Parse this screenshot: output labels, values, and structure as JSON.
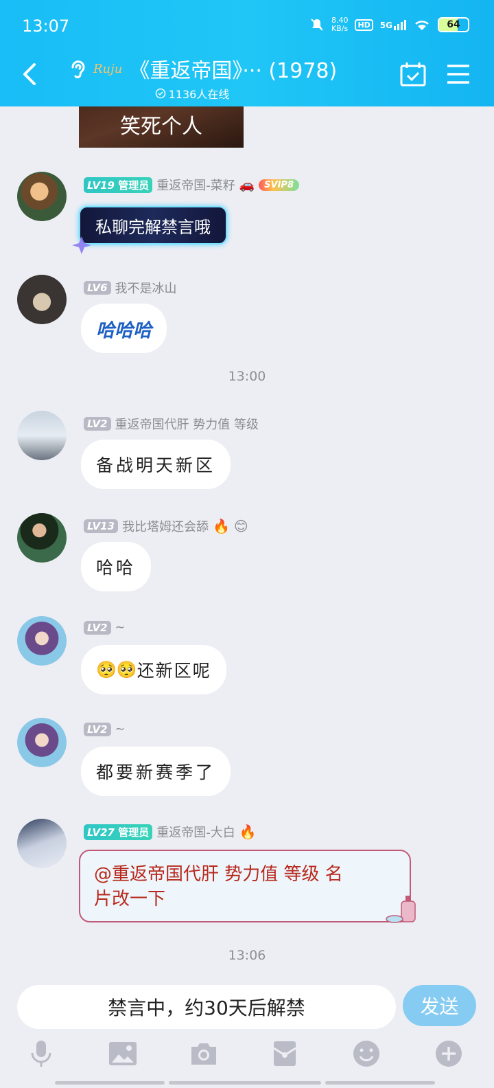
{
  "status": {
    "time": "13:07",
    "net_speed_value": "8.40",
    "net_speed_unit": "KB/s",
    "hd": "HD",
    "signal": "5G",
    "battery": "64",
    "battery_level": 0.64
  },
  "header": {
    "title": "《重返帝国》··· (1978)",
    "logo_text": "Ruju",
    "online": "1136人在线"
  },
  "messages": {
    "image_caption": "笑死个人",
    "m1": {
      "level": "LV19",
      "role": "管理员",
      "name": "重返帝国-菜籽",
      "badge": "SVIP8",
      "text": "私聊完解禁言哦"
    },
    "m2": {
      "level": "LV6",
      "name": "我不是冰山",
      "text": "哈哈哈"
    },
    "ts1": "13:00",
    "m3": {
      "level": "LV2",
      "name": "重返帝国代肝 势力值 等级",
      "text": "备战明天新区"
    },
    "m4": {
      "level": "LV13",
      "name": "我比塔姆还会舔",
      "text": "哈哈"
    },
    "m5": {
      "level": "LV2",
      "name": "~",
      "text": "还新区呢"
    },
    "m6": {
      "level": "LV2",
      "name": "~",
      "text": "都要新赛季了"
    },
    "m7": {
      "level": "LV27",
      "role": "管理员",
      "name": "重返帝国-大白",
      "text_line1": "@重返帝国代肝 势力值 等级 名",
      "text_line2": "片改一下"
    },
    "ts2": "13:06"
  },
  "input": {
    "placeholder": "禁言中，约30天后解禁",
    "send": "发送"
  },
  "colors": {
    "header_start": "#19bdf7",
    "send_button": "#86ccf2",
    "admin_badge": "#2fc6c6",
    "level_badge": "#b7b9c5",
    "background": "#edeef3"
  }
}
